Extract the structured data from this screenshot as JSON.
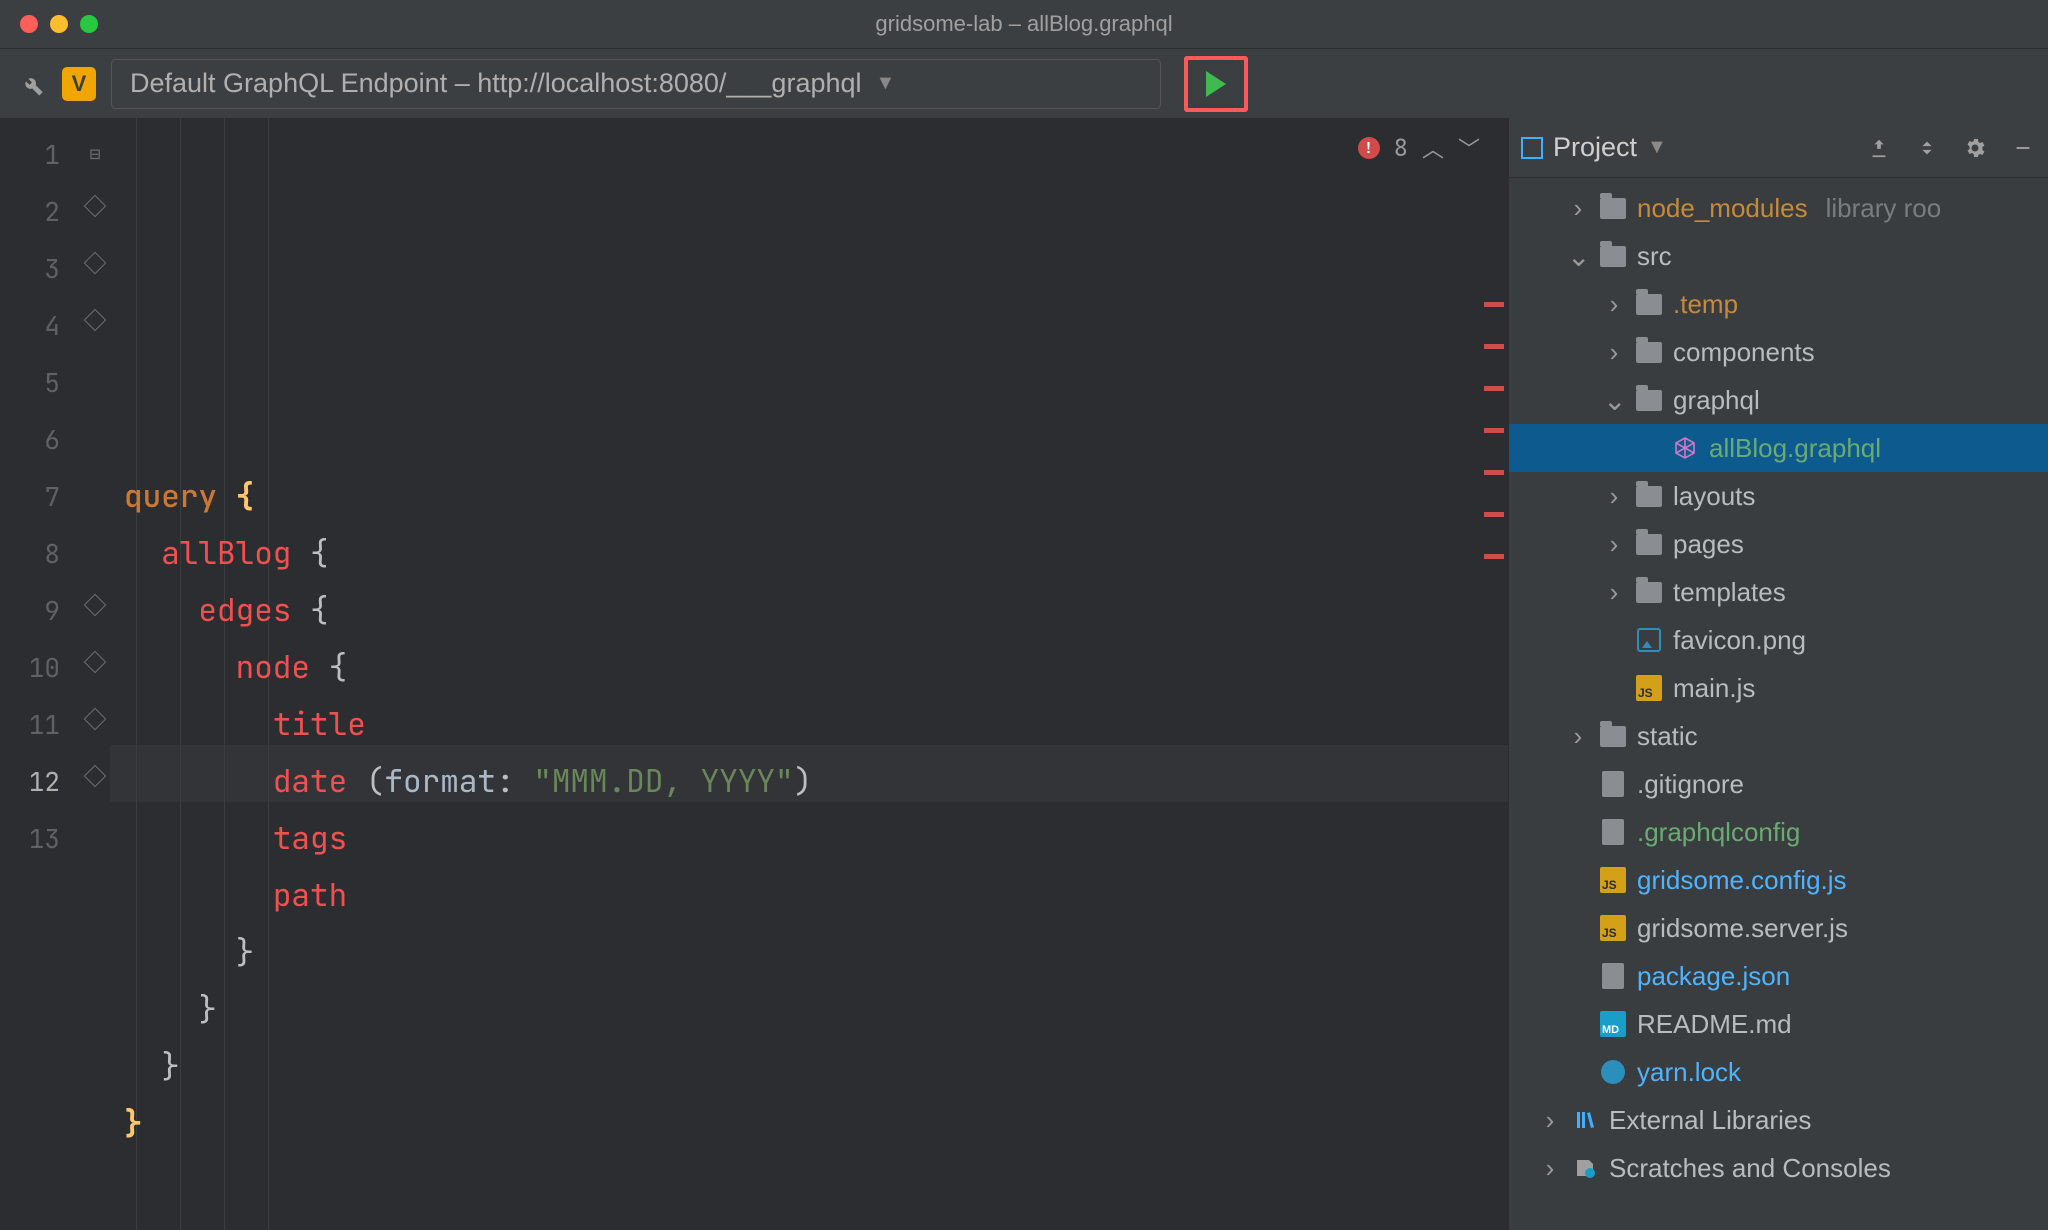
{
  "window": {
    "title": "gridsome-lab – allBlog.graphql"
  },
  "toolbar": {
    "variables_badge": "V",
    "endpoint_label": "Default GraphQL Endpoint – http://localhost:8080/___graphql"
  },
  "editor": {
    "gutter": [
      "1",
      "2",
      "3",
      "4",
      "5",
      "6",
      "7",
      "8",
      "9",
      "10",
      "11",
      "12",
      "13"
    ],
    "current_line_index": 11,
    "code_tokens": [
      [
        {
          "t": "query ",
          "c": "kw-orange"
        },
        {
          "t": "{",
          "c": "brace-y"
        }
      ],
      [
        {
          "t": "  ",
          "c": ""
        },
        {
          "t": "allBlog",
          "c": "ident-red"
        },
        {
          "t": " {",
          "c": "punct"
        }
      ],
      [
        {
          "t": "    ",
          "c": ""
        },
        {
          "t": "edges",
          "c": "ident-red"
        },
        {
          "t": " {",
          "c": "punct"
        }
      ],
      [
        {
          "t": "      ",
          "c": ""
        },
        {
          "t": "node",
          "c": "ident-red"
        },
        {
          "t": " {",
          "c": "punct"
        }
      ],
      [
        {
          "t": "        ",
          "c": ""
        },
        {
          "t": "title",
          "c": "ident-red"
        }
      ],
      [
        {
          "t": "        ",
          "c": ""
        },
        {
          "t": "date",
          "c": "ident-red"
        },
        {
          "t": " (",
          "c": "punct"
        },
        {
          "t": "format",
          "c": "arg"
        },
        {
          "t": ": ",
          "c": "punct"
        },
        {
          "t": "\"MMM.DD, YYYY\"",
          "c": "str"
        },
        {
          "t": ")",
          "c": "punct"
        }
      ],
      [
        {
          "t": "        ",
          "c": ""
        },
        {
          "t": "tags",
          "c": "ident-red"
        }
      ],
      [
        {
          "t": "        ",
          "c": ""
        },
        {
          "t": "path",
          "c": "ident-red"
        }
      ],
      [
        {
          "t": "      }",
          "c": "punct"
        }
      ],
      [
        {
          "t": "    }",
          "c": "punct"
        }
      ],
      [
        {
          "t": "  }",
          "c": "punct"
        }
      ],
      [
        {
          "t": "}",
          "c": "brace-y"
        }
      ],
      [
        {
          "t": "",
          "c": ""
        }
      ]
    ],
    "inspection": {
      "error_count": "8"
    },
    "error_stripe_rows": [
      2,
      3,
      4,
      5,
      6,
      7,
      8
    ]
  },
  "sidebar": {
    "header": {
      "title": "Project"
    },
    "tree": [
      {
        "indent": 1,
        "arrow": "right",
        "icon": "folder",
        "label": "node_modules",
        "label_cls": "hl-orange",
        "suffix": "library roo",
        "suffix_cls": "muted"
      },
      {
        "indent": 1,
        "arrow": "down",
        "icon": "folder",
        "label": "src",
        "label_cls": "hl-dir"
      },
      {
        "indent": 2,
        "arrow": "right",
        "icon": "folder",
        "label": ".temp",
        "label_cls": "hl-orange"
      },
      {
        "indent": 2,
        "arrow": "right",
        "icon": "folder",
        "label": "components",
        "label_cls": "hl-dir"
      },
      {
        "indent": 2,
        "arrow": "down",
        "icon": "folder",
        "label": "graphql",
        "label_cls": "hl-dir"
      },
      {
        "indent": 3,
        "arrow": "blank",
        "icon": "graphql",
        "label": "allBlog.graphql",
        "label_cls": "hl-green",
        "selected": true
      },
      {
        "indent": 2,
        "arrow": "right",
        "icon": "folder",
        "label": "layouts",
        "label_cls": "hl-dir"
      },
      {
        "indent": 2,
        "arrow": "right",
        "icon": "folder",
        "label": "pages",
        "label_cls": "hl-dir"
      },
      {
        "indent": 2,
        "arrow": "right",
        "icon": "folder",
        "label": "templates",
        "label_cls": "hl-dir"
      },
      {
        "indent": 2,
        "arrow": "blank",
        "icon": "image",
        "label": "favicon.png",
        "label_cls": "hl-dir"
      },
      {
        "indent": 2,
        "arrow": "blank",
        "icon": "js",
        "label": "main.js",
        "label_cls": "hl-dir"
      },
      {
        "indent": 1,
        "arrow": "right",
        "icon": "folder",
        "label": "static",
        "label_cls": "hl-dir"
      },
      {
        "indent": 1,
        "arrow": "blank",
        "icon": "file",
        "label": ".gitignore",
        "label_cls": "hl-dir"
      },
      {
        "indent": 1,
        "arrow": "blank",
        "icon": "file",
        "label": ".graphqlconfig",
        "label_cls": "hl-green"
      },
      {
        "indent": 1,
        "arrow": "blank",
        "icon": "js",
        "label": "gridsome.config.js",
        "label_cls": "hl-blue"
      },
      {
        "indent": 1,
        "arrow": "blank",
        "icon": "js",
        "label": "gridsome.server.js",
        "label_cls": "hl-dir"
      },
      {
        "indent": 1,
        "arrow": "blank",
        "icon": "file",
        "label": "package.json",
        "label_cls": "hl-blue"
      },
      {
        "indent": 1,
        "arrow": "blank",
        "icon": "md",
        "label": "README.md",
        "label_cls": "hl-dir"
      },
      {
        "indent": 1,
        "arrow": "blank",
        "icon": "yarn",
        "label": "yarn.lock",
        "label_cls": "hl-blue"
      },
      {
        "indent": 0,
        "arrow": "right",
        "icon": "lib",
        "label": "External Libraries",
        "label_cls": "hl-dir"
      },
      {
        "indent": 0,
        "arrow": "right",
        "icon": "scratch",
        "label": "Scratches and Consoles",
        "label_cls": "hl-dir"
      }
    ]
  }
}
